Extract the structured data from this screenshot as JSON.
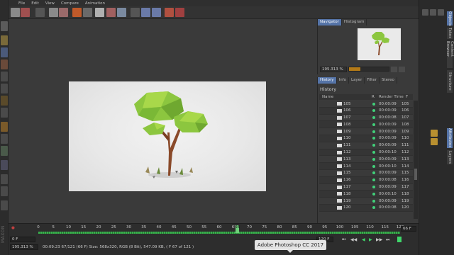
{
  "menu": [
    "File",
    "Edit",
    "View",
    "Compare",
    "Animation"
  ],
  "navigator": {
    "tabs": [
      "Navigator",
      "Histogram"
    ],
    "zoom": "195.313 %"
  },
  "history_panel": {
    "tabs": [
      "History",
      "Info",
      "Layer",
      "Filter",
      "Stereo"
    ],
    "title": "History",
    "columns": {
      "name": "Name",
      "r": "R",
      "render_time": "Render Time",
      "f": "F"
    },
    "rows": [
      {
        "name": "105",
        "time": "00:00:09",
        "frame": "105"
      },
      {
        "name": "106",
        "time": "00:00:09",
        "frame": "106"
      },
      {
        "name": "107",
        "time": "00:00:08",
        "frame": "107"
      },
      {
        "name": "108",
        "time": "00:00:09",
        "frame": "108"
      },
      {
        "name": "109",
        "time": "00:00:09",
        "frame": "109"
      },
      {
        "name": "110",
        "time": "00:00:09",
        "frame": "110"
      },
      {
        "name": "111",
        "time": "00:00:09",
        "frame": "111"
      },
      {
        "name": "112",
        "time": "00:00:10",
        "frame": "112"
      },
      {
        "name": "113",
        "time": "00:00:09",
        "frame": "113"
      },
      {
        "name": "114",
        "time": "00:00:10",
        "frame": "114"
      },
      {
        "name": "115",
        "time": "00:00:09",
        "frame": "115"
      },
      {
        "name": "116",
        "time": "00:00:08",
        "frame": "116"
      },
      {
        "name": "117",
        "time": "00:00:09",
        "frame": "117"
      },
      {
        "name": "118",
        "time": "00:00:10",
        "frame": "118"
      },
      {
        "name": "119",
        "time": "00:00:09",
        "frame": "119"
      },
      {
        "name": "120",
        "time": "00:00:08",
        "frame": "120"
      }
    ]
  },
  "right_dock_tabs": [
    "Objects",
    "Takes",
    "Content Browser",
    "Structure",
    "Attributes",
    "Layers"
  ],
  "timeline": {
    "ticks": [
      "0",
      "5",
      "10",
      "15",
      "20",
      "25",
      "30",
      "35",
      "40",
      "45",
      "50",
      "55",
      "60",
      "65",
      "66",
      "70",
      "75",
      "80",
      "85",
      "90",
      "95",
      "100",
      "105",
      "110",
      "115",
      "120"
    ],
    "current_frame": "66 F",
    "playhead_frame": "66",
    "start_field": "0 F",
    "end_field": "120 F",
    "end_field_right": "120 F",
    "end_field_right2": "120 F",
    "transport": [
      "⏮",
      "◀◀",
      "◀",
      "▶",
      "▶▶",
      "⏭"
    ]
  },
  "status": {
    "zoom": "195.313 %",
    "info": "00:09:23  67/121 (66 F)   Size: 568x320, RGB (8 Bit), 547.09 KB,  ( F 67 of 121 )"
  },
  "tooltip": "Adobe Photoshop CC 2017",
  "colors": {
    "accent_blue": "#5574a8",
    "status_green": "#41d07a",
    "key_green": "#39b24d",
    "slider_orange": "#b37a18"
  }
}
